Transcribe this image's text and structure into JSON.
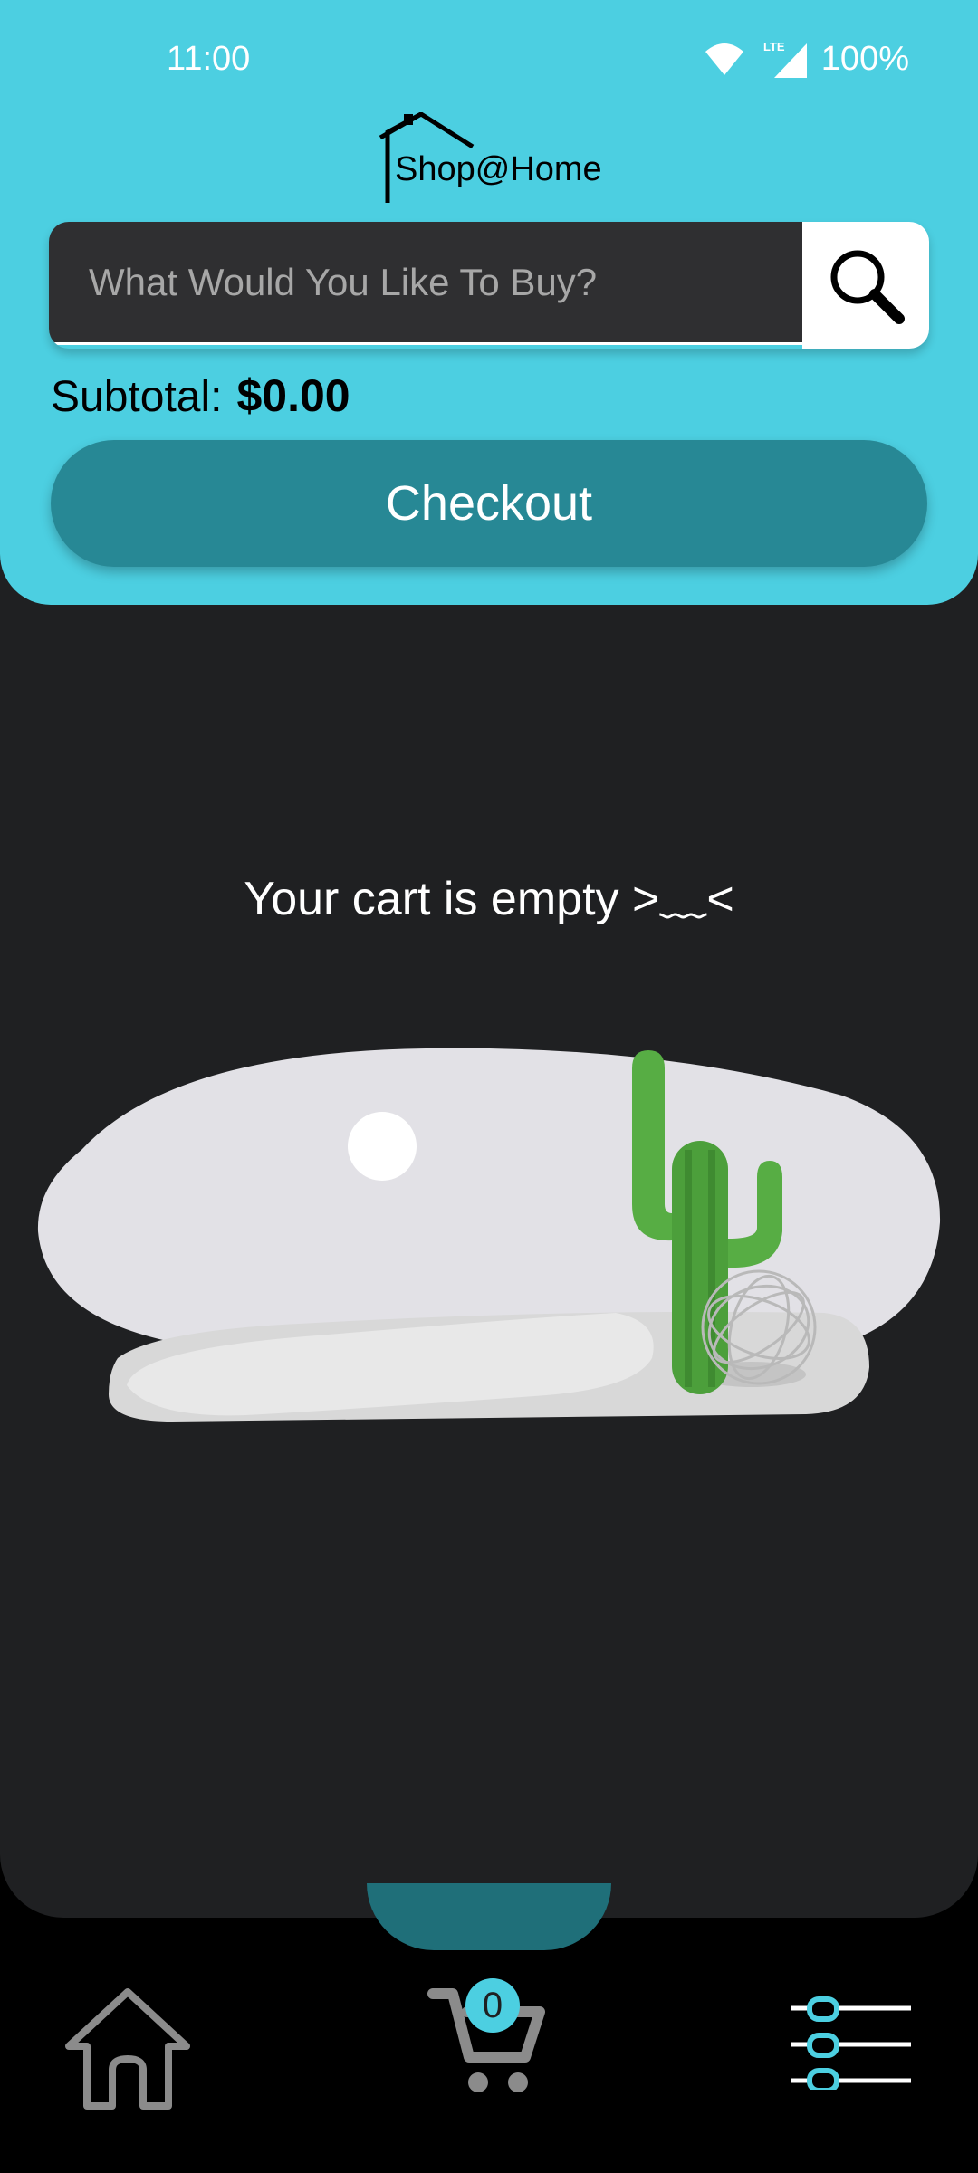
{
  "status_bar": {
    "time": "11:00",
    "battery": "100%",
    "network": "LTE"
  },
  "header": {
    "logo_text": "Shop@Home"
  },
  "search": {
    "placeholder": "What Would You Like To Buy?",
    "value": ""
  },
  "cart": {
    "subtotal_label": "Subtotal:",
    "subtotal_value": "$0.00",
    "checkout_label": "Checkout",
    "empty_message": "Your cart is empty >﹏<",
    "item_count": "0"
  },
  "colors": {
    "header": "#4ccfe1",
    "checkout": "#278895",
    "background": "#1f2022",
    "nav": "#000000"
  },
  "nav": {
    "items": [
      {
        "icon": "home-icon"
      },
      {
        "icon": "cart-icon"
      },
      {
        "icon": "menu-icon"
      }
    ]
  }
}
